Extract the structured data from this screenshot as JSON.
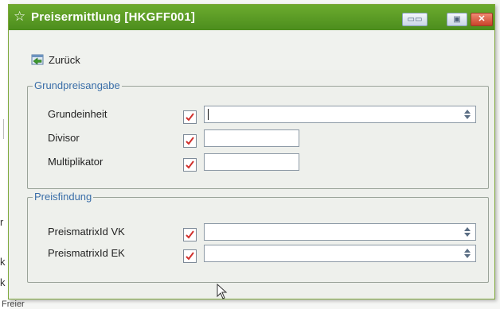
{
  "window": {
    "title": "Preisermittlung [HKGFF001]",
    "accent_color": "#5a9d24",
    "title_icon": "star-icon",
    "controls": [
      "restore-icon",
      "maximize-icon",
      "close-icon"
    ]
  },
  "toolbar": {
    "back_label": "Zurück",
    "back_icon": "back-arrow-icon"
  },
  "groups": {
    "grundpreis": {
      "legend": "Grundpreisangabe",
      "rows": [
        {
          "label": "Grundeinheit",
          "value": "",
          "type": "select"
        },
        {
          "label": "Divisor",
          "value": "",
          "type": "text"
        },
        {
          "label": "Multiplikator",
          "value": "",
          "type": "text"
        }
      ]
    },
    "preisfindung": {
      "legend": "Preisfindung",
      "rows": [
        {
          "label": "PreismatrixId VK",
          "value": "",
          "type": "select"
        },
        {
          "label": "PreismatrixId EK",
          "value": "",
          "type": "select"
        }
      ]
    }
  },
  "background": {
    "partial_text": [
      "r",
      "k",
      "k"
    ],
    "footer": "Freier"
  }
}
